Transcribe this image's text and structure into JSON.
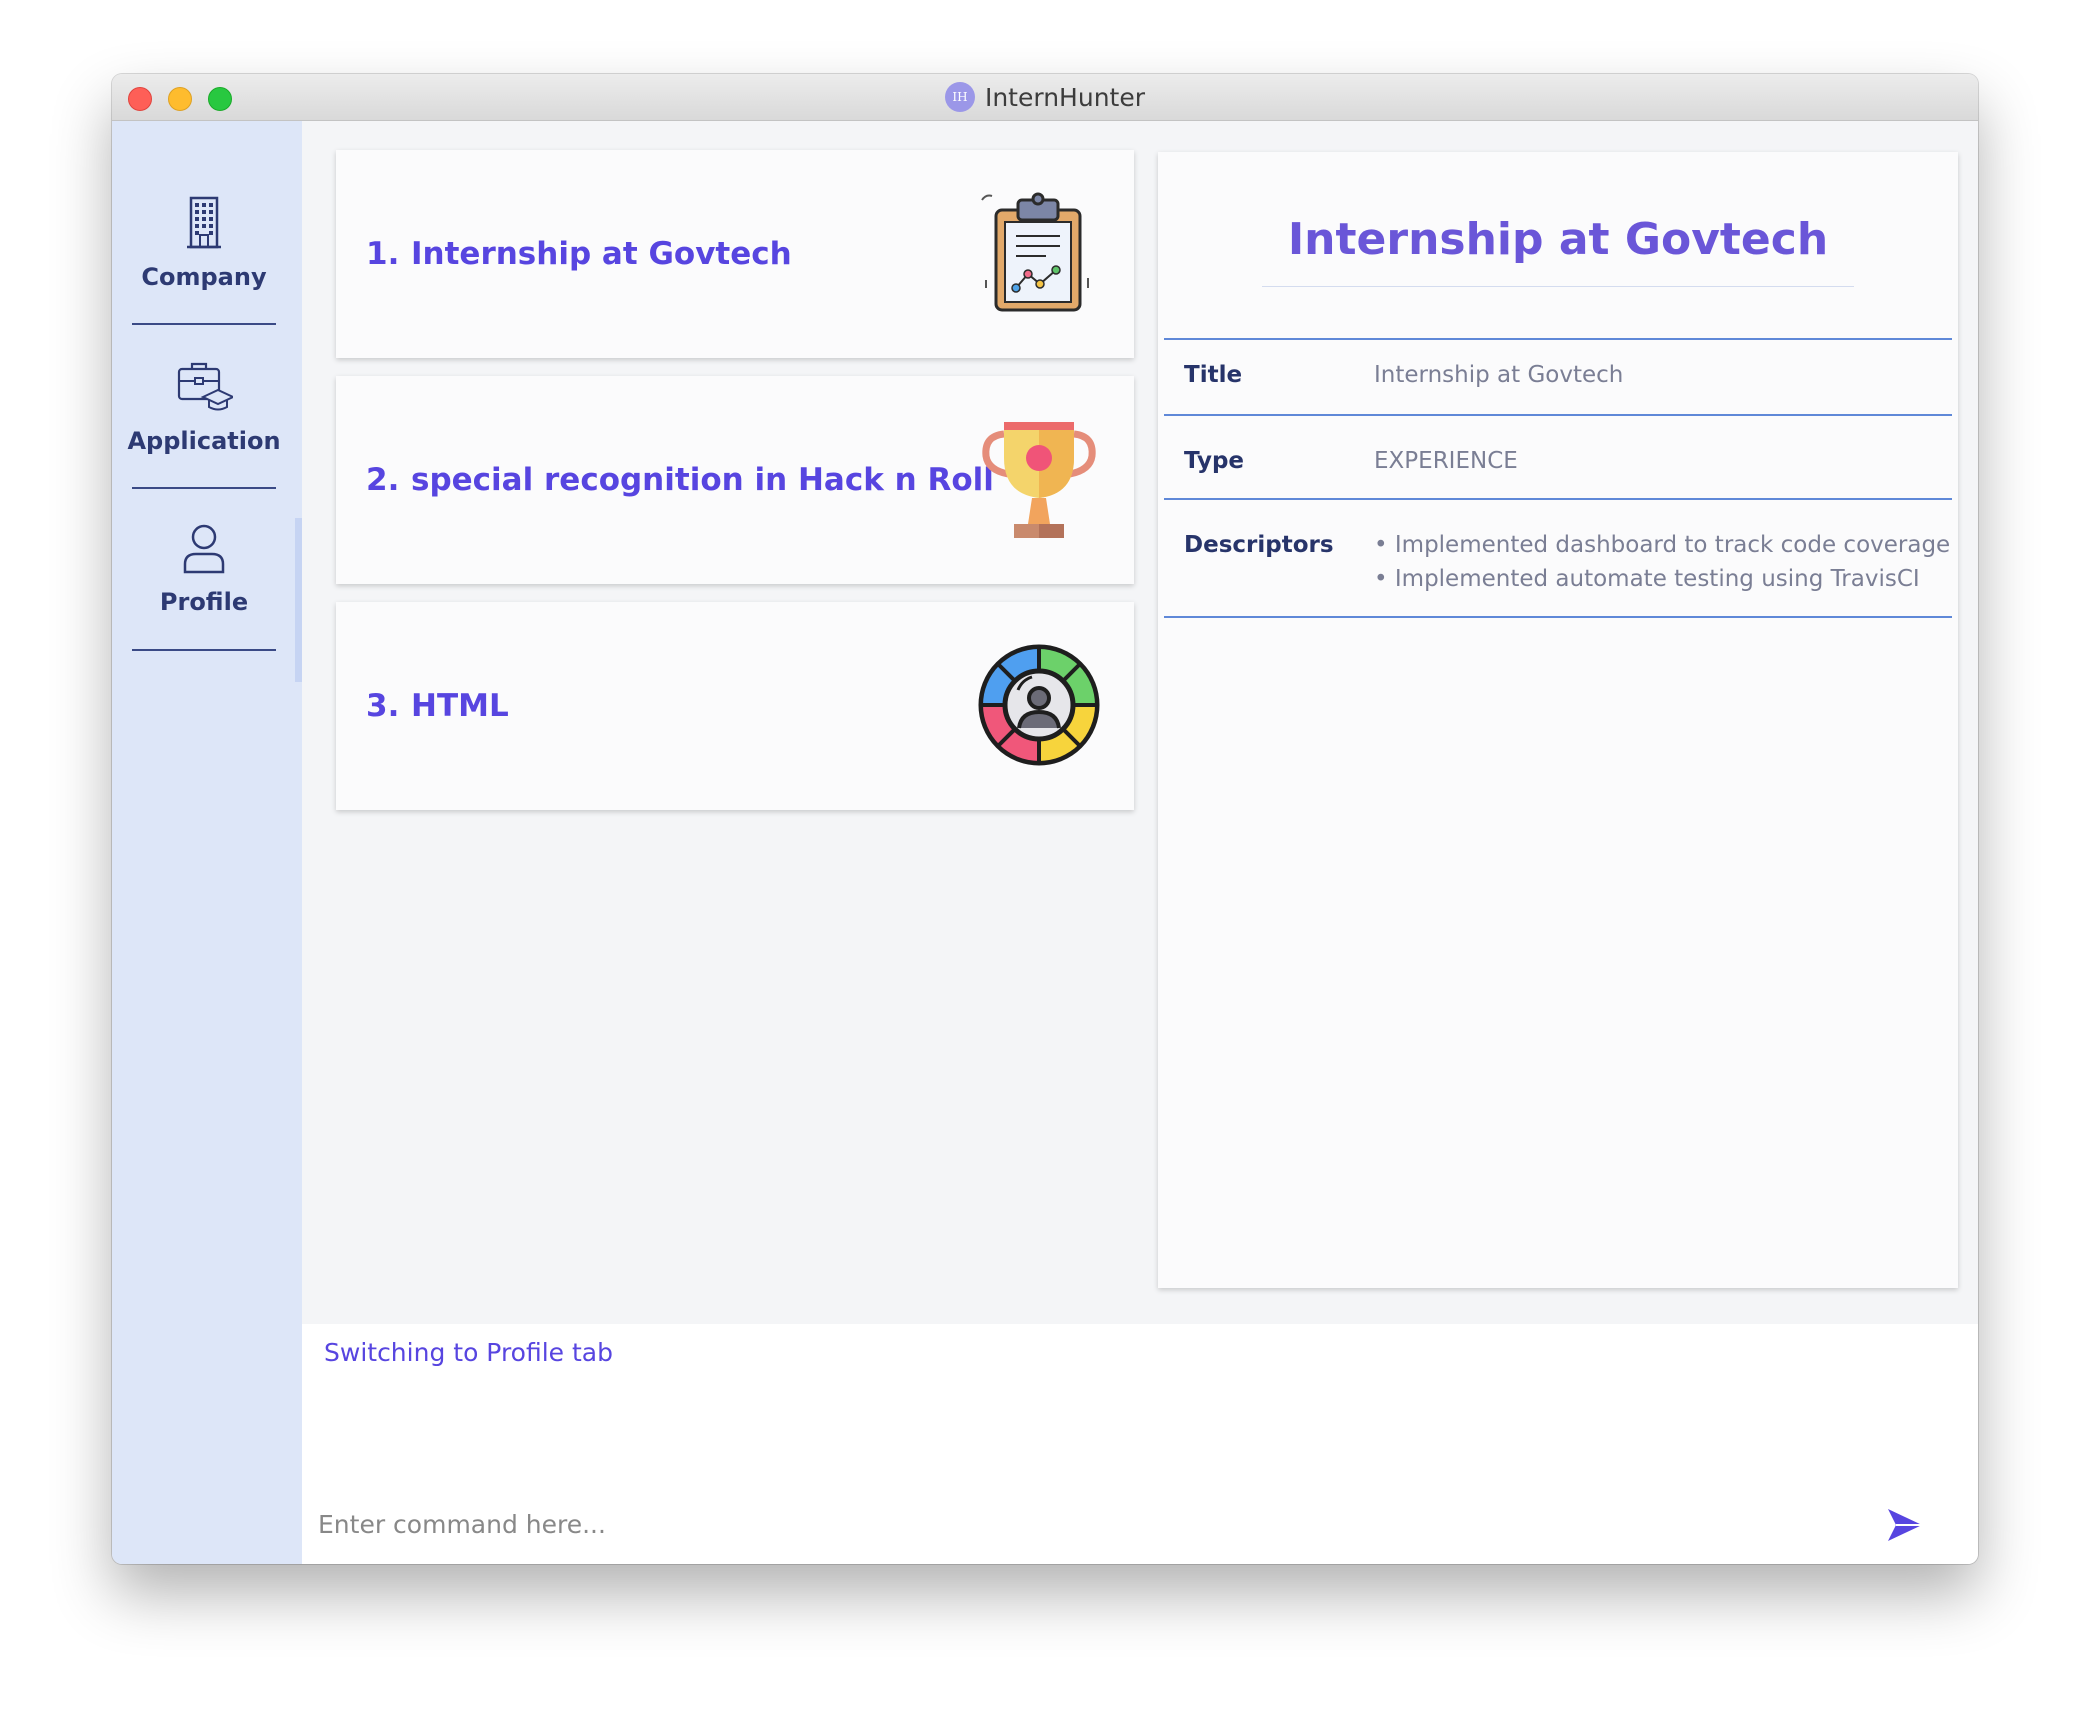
{
  "window": {
    "title": "InternHunter",
    "logo_text": "IH"
  },
  "sidebar": {
    "items": [
      {
        "label": "Company",
        "icon": "building-icon"
      },
      {
        "label": "Application",
        "icon": "briefcase-graduation-icon"
      },
      {
        "label": "Profile",
        "icon": "user-icon"
      }
    ],
    "active": "Profile"
  },
  "profile_list": {
    "items": [
      {
        "index": "1.",
        "title": "Internship at Govtech",
        "icon": "clipboard-chart-icon"
      },
      {
        "index": "2.",
        "title": "special recognition in Hack n Roll",
        "icon": "trophy-icon"
      },
      {
        "index": "3.",
        "title": "HTML",
        "icon": "skill-wheel-icon"
      }
    ]
  },
  "detail": {
    "heading": "Internship at Govtech",
    "rows": [
      {
        "label": "Title",
        "value": "Internship at Govtech"
      },
      {
        "label": "Type",
        "value": "EXPERIENCE"
      },
      {
        "label": "Descriptors",
        "values": [
          "• Implemented dashboard to track code coverage",
          "• Implemented automate testing using TravisCI"
        ]
      }
    ]
  },
  "result_display": {
    "text": "Switching to Profile tab"
  },
  "command_box": {
    "placeholder": "Enter command here...",
    "value": ""
  },
  "colors": {
    "accent": "#5745e0",
    "sidebar_bg": "#dde6f8",
    "sidebar_text": "#2d3a73",
    "divider": "#5f88d8"
  }
}
